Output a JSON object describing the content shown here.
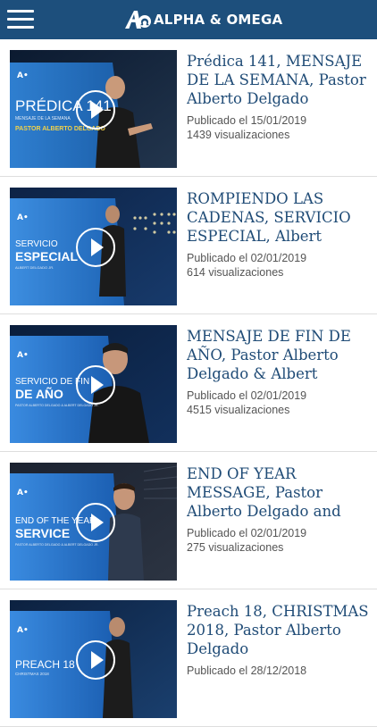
{
  "header": {
    "menu_icon": "hamburger-menu-icon",
    "logo_icon": "alpha-omega-logo-icon",
    "brand": "ALPHA & OMEGA",
    "color": "#1d4f7c"
  },
  "videos": [
    {
      "title": "Prédica 141, MENSAJE DE LA SEMANA, Pastor Alberto Delgado",
      "published": "Publicado el 15/01/2019",
      "views": "1439 visualizaciones",
      "thumb": {
        "line1": "PRÉDICA 141",
        "line2": "MENSAJE DE LA SEMANA",
        "line3": "PASTOR ALBERTO DELGADO"
      }
    },
    {
      "title": "ROMPIENDO LAS CADENAS, SERVICIO ESPECIAL, Albert",
      "published": "Publicado el 02/01/2019",
      "views": "614 visualizaciones",
      "thumb": {
        "line1": "SERVICIO",
        "line2": "ESPECIAL",
        "line3": "ALBERT DELGADO JR."
      }
    },
    {
      "title": "MENSAJE DE FIN DE AÑO, Pastor Alberto Delgado & Albert Delgado",
      "published": "Publicado el 02/01/2019",
      "views": "4515 visualizaciones",
      "thumb": {
        "line1": "SERVICIO DE FIN",
        "line2": "DE AÑO",
        "line3": "PASTOR ALBERTO DELGADO & ALBERT DELGADO JR."
      }
    },
    {
      "title": "END OF YEAR MESSAGE, Pastor Alberto Delgado and Albert Delgado JR.",
      "published": "Publicado el 02/01/2019",
      "views": "275 visualizaciones",
      "thumb": {
        "line1": "END OF THE YEAR",
        "line2": "SERVICE",
        "line3": "PASTOR ALBERTO DELGADO & ALBERT DELGADO JR."
      }
    },
    {
      "title": "Preach 18, CHRISTMAS 2018, Pastor Alberto Delgado",
      "published": "Publicado el 28/12/2018",
      "views": "",
      "thumb": {
        "line1": "PREACH 18",
        "line2": "CHRISTMAS 2018",
        "line3": ""
      }
    }
  ]
}
